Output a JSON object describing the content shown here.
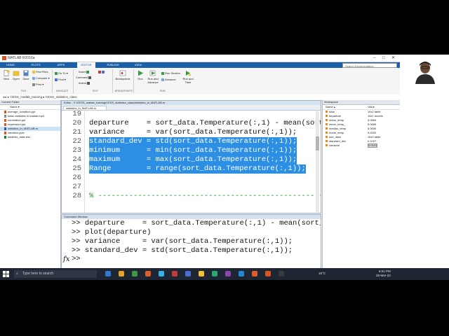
{
  "window": {
    "title": "MATLAB R2016a",
    "controls": [
      "–",
      "□",
      "✕"
    ]
  },
  "toolstrip": {
    "tabs": [
      "HOME",
      "PLOTS",
      "APPS",
      "EDITOR",
      "PUBLISH",
      "VIEW"
    ],
    "active_tab": "EDITOR",
    "search_placeholder": "Search Documentation",
    "buttons": {
      "new": "New",
      "open": "Open",
      "save": "Save",
      "find_files": "Find Files",
      "compare": "Compare",
      "print": "Print",
      "insert": "Insert",
      "comment": "Comment",
      "indent": "Indent",
      "go_to": "Go To",
      "find": "Find",
      "breakpoints": "Breakpoints",
      "run": "Run",
      "run_and_advance": "Run and Advance",
      "run_section": "Run Section",
      "advance": "Advance",
      "run_and_time": "Run and Time"
    },
    "groups": [
      "FILE",
      "NAVIGATE",
      "EDIT",
      "BREAKPOINTS",
      "RUN"
    ]
  },
  "address_bar": {
    "path": "▸ CESS_matlab_training ▸ CESS_statistics_class"
  },
  "current_folder": {
    "title": "Current Folder",
    "column": "Name ▾",
    "files": [
      {
        "name": "average_condition.ppt",
        "color": "#d9541e"
      },
      {
        "name": "basic statistics in matlab.mp4",
        "color": "#888888"
      },
      {
        "name": "correlation.ppt",
        "color": "#d9541e"
      },
      {
        "name": "regression.ppt",
        "color": "#d9541e"
      },
      {
        "name": "statistics_in_MATLAB.m",
        "color": "#1f5fa6"
      },
      {
        "name": "variation.pptx",
        "color": "#d9541e"
      },
      {
        "name": "weather_data.xlsx",
        "color": "#1e7a3a"
      }
    ],
    "selected_index": 4,
    "details": "statistics_in_MATLAB.m  (Script)"
  },
  "editor": {
    "title": "Editor - F:\\CESS_matlab_training\\CESS_statistics_class\\statistics_in_MATLAB.m",
    "tab": "statistics_in_MATLAB.m",
    "lines": [
      {
        "num": "19",
        "text": "",
        "hl": false,
        "comment": false
      },
      {
        "num": "20",
        "text": "departure    = sort_data.Temperature(:,1) - mean(sort_d",
        "hl": false,
        "comment": false
      },
      {
        "num": "21",
        "text": "variance     = var(sort_data.Temperature(:,1));",
        "hl": false,
        "comment": false
      },
      {
        "num": "22",
        "text": "standard_dev = std(sort_data.Temperature(:,1));",
        "hl": true,
        "comment": false
      },
      {
        "num": "23",
        "text": "minimum      = min(sort_data.Temperature(:,1));",
        "hl": true,
        "comment": false
      },
      {
        "num": "24",
        "text": "maximum      = max(sort_data.Temperature(:,1));",
        "hl": true,
        "comment": false
      },
      {
        "num": "25",
        "text": "Range        = range(sort_data.Temperature(:,1));",
        "hl": true,
        "comment": false
      },
      {
        "num": "26",
        "text": "",
        "hl": false,
        "comment": false
      },
      {
        "num": "27",
        "text": "",
        "hl": false,
        "comment": false
      },
      {
        "num": "28",
        "text": "% ------------------------------------------------------",
        "hl": false,
        "comment": true
      }
    ]
  },
  "command_window": {
    "title": "Command Window",
    "lines": [
      ">> departure    = sort_data.Temperature(:,1) - mean(sort_da",
      ">> plot(departure)",
      ">> variance     = var(sort_data.Temperature(:,1));",
      ">> standard_dev = std(sort_data.Temperature(:,1));"
    ],
    "fx": "fx",
    "prompt": ">>"
  },
  "workspace": {
    "title": "Workspace",
    "col_name": "Name ▴",
    "col_value": "Value",
    "vars": [
      {
        "name": "data",
        "value": "16x2 table"
      },
      {
        "name": "departure",
        "value": "16x1 double"
      },
      {
        "name": "mean_temp",
        "value": "5.0669"
      },
      {
        "name": "mean_temp_",
        "value": "5.0669"
      },
      {
        "name": "median_temp",
        "value": "5.0650"
      },
      {
        "name": "mode_temp",
        "value": "5.0000"
      },
      {
        "name": "sort_data",
        "value": "16x2 table"
      },
      {
        "name": "standard_dev",
        "value": "0.1007"
      },
      {
        "name": "variance",
        "value": "0.0101"
      }
    ]
  },
  "status": {
    "text": "",
    "mode": "script",
    "ln": "Ln  25",
    "col": "Col  50"
  },
  "taskbar": {
    "search_placeholder": "Type here to search",
    "temperature": "15°C",
    "time": "6:51 PM",
    "date": "26-Mar-22",
    "app_colors": [
      "#2e79d6",
      "#e7a321",
      "#3c9a43",
      "#e35b2a",
      "#36b3e6",
      "#c13b3b",
      "#4b6fd1",
      "#f2c233",
      "#2ba86e",
      "#8e44ad",
      "#1f8ad0",
      "#e55a2b",
      "#d9541e",
      "#3b3b3b"
    ]
  }
}
